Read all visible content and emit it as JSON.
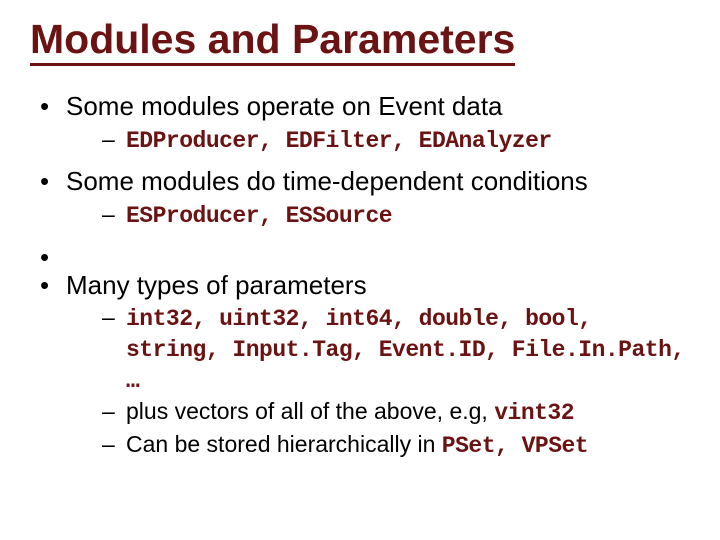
{
  "title": "Modules and Parameters",
  "b1": {
    "text": "Some modules operate on Event data",
    "sub1": "EDProducer, EDFilter, EDAnalyzer"
  },
  "b2": {
    "text": "Some modules do time-dependent conditions",
    "sub1": "ESProducer, ESSource"
  },
  "b3": {
    "text": "Many types of parameters",
    "sub1": "int32, uint32, int64, double, bool, string, Input.Tag, Event.ID, File.In.Path, …",
    "sub2a": "plus vectors of all of the above, e.g, ",
    "sub2b": "vint32",
    "sub3a": "Can be stored hierarchically in ",
    "sub3b": "PSet, VPSet"
  }
}
